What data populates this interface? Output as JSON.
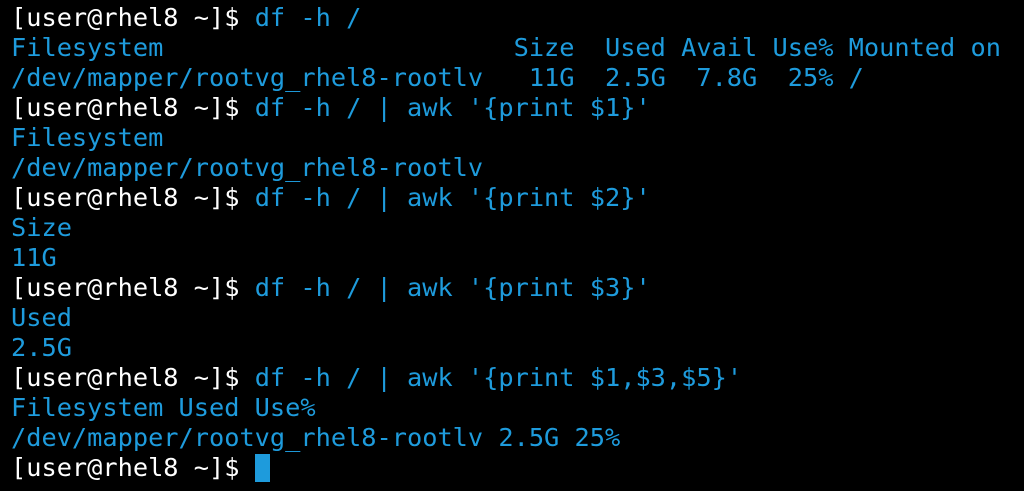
{
  "colors": {
    "background": "#000000",
    "prompt": "#ffffff",
    "text": "#1e9bdc",
    "cursor": "#1e9bdc"
  },
  "terminal": {
    "prompt": "[user@rhel8 ~]$ ",
    "lines": [
      {
        "type": "command",
        "text": "df -h /"
      },
      {
        "type": "output",
        "text": "Filesystem                       Size  Used Avail Use% Mounted on"
      },
      {
        "type": "output",
        "text": "/dev/mapper/rootvg_rhel8-rootlv   11G  2.5G  7.8G  25% /"
      },
      {
        "type": "command",
        "text": "df -h / | awk '{print $1}'"
      },
      {
        "type": "output",
        "text": "Filesystem"
      },
      {
        "type": "output",
        "text": "/dev/mapper/rootvg_rhel8-rootlv"
      },
      {
        "type": "command",
        "text": "df -h / | awk '{print $2}'"
      },
      {
        "type": "output",
        "text": "Size"
      },
      {
        "type": "output",
        "text": "11G"
      },
      {
        "type": "command",
        "text": "df -h / | awk '{print $3}'"
      },
      {
        "type": "output",
        "text": "Used"
      },
      {
        "type": "output",
        "text": "2.5G"
      },
      {
        "type": "command",
        "text": "df -h / | awk '{print $1,$3,$5}'"
      },
      {
        "type": "output",
        "text": "Filesystem Used Use%"
      },
      {
        "type": "output",
        "text": "/dev/mapper/rootvg_rhel8-rootlv 2.5G 25%"
      },
      {
        "type": "input",
        "text": ""
      }
    ]
  }
}
